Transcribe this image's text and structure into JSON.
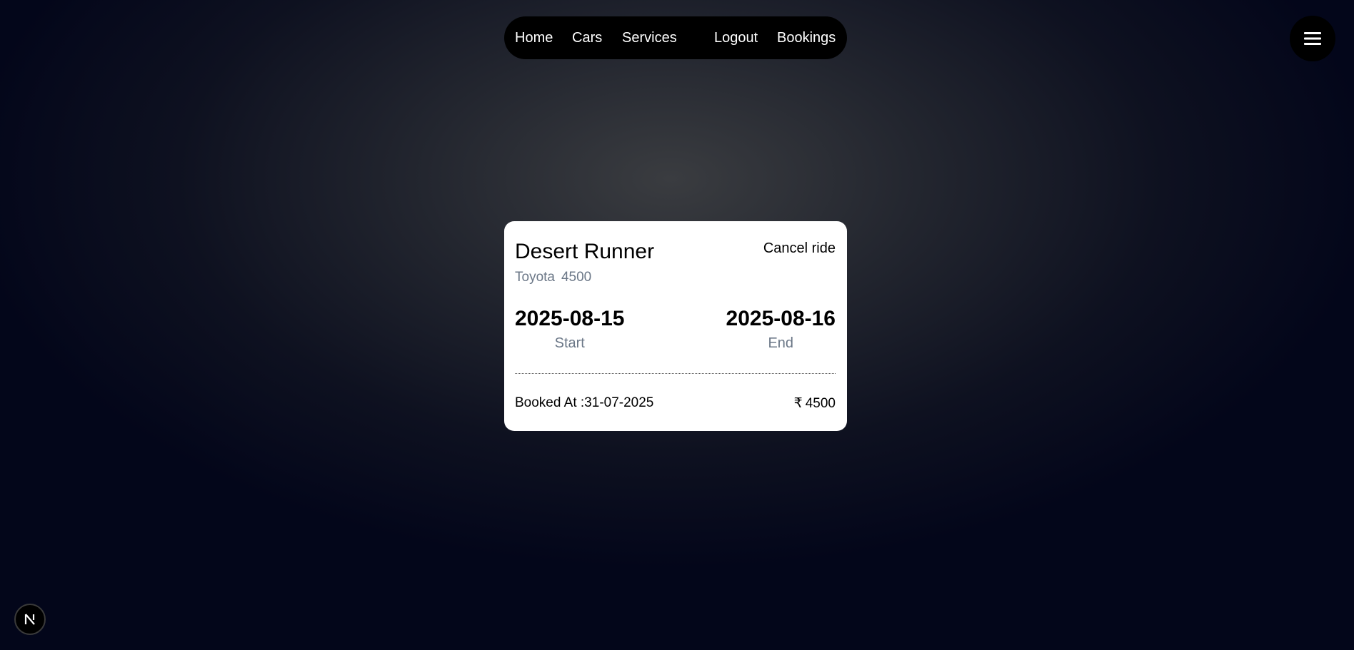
{
  "nav": {
    "links": [
      {
        "label": "Home"
      },
      {
        "label": "Cars"
      },
      {
        "label": "Services"
      },
      {
        "label": "Logout"
      },
      {
        "label": "Bookings"
      }
    ]
  },
  "menu_button": {
    "icon": "hamburger-menu-icon"
  },
  "booking": {
    "car_name": "Desert Runner",
    "brand": "Toyota",
    "model": "4500",
    "cancel_label": "Cancel ride",
    "start_date": "2025-08-15",
    "start_label": "Start",
    "end_date": "2025-08-16",
    "end_label": "End",
    "booked_at_label": "Booked At :31-07-2025",
    "currency_symbol": "₹",
    "price": "4500"
  },
  "dev_badge": {
    "icon": "nextjs-logo-icon",
    "letter": "N"
  },
  "colors": {
    "nav_bg": "#000000",
    "card_bg": "#ffffff",
    "muted_text": "#6b7787"
  }
}
